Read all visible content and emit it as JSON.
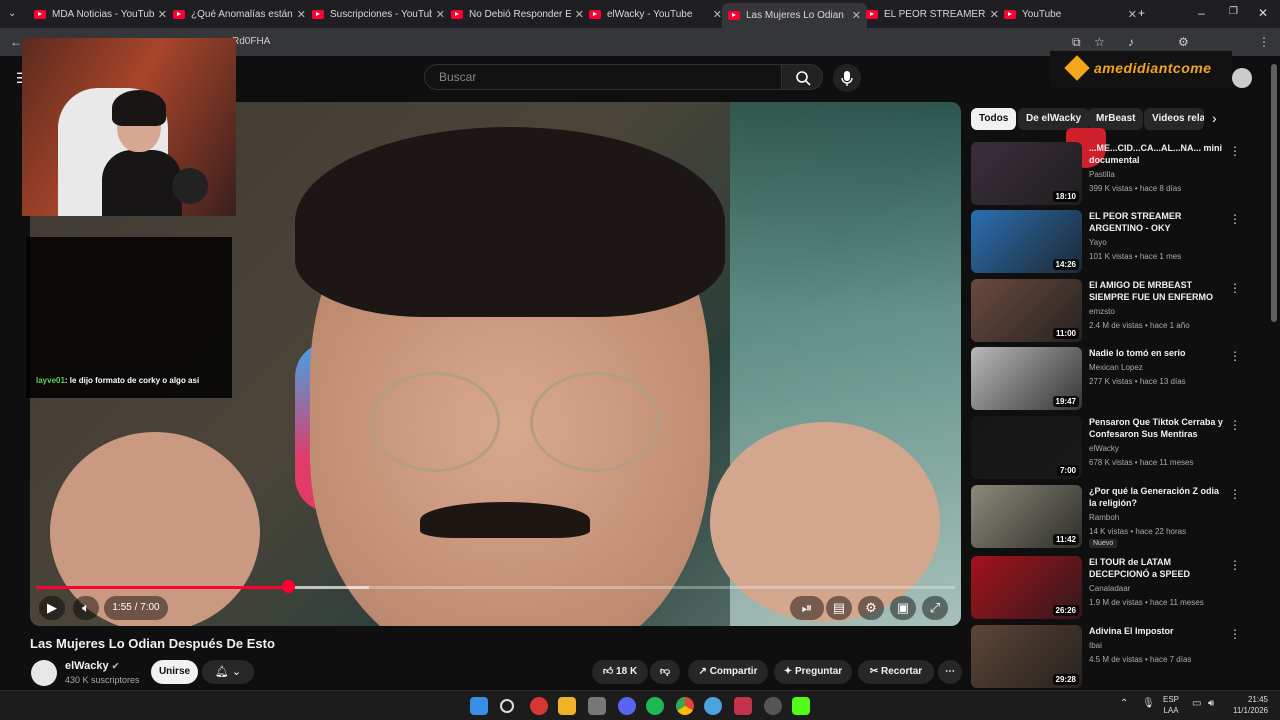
{
  "browser": {
    "tabs": [
      {
        "title": "MDA Noticias - YouTube",
        "active": false
      },
      {
        "title": "¿Qué Anomalías están pr",
        "active": false
      },
      {
        "title": "Suscripciones - YouTube",
        "active": false
      },
      {
        "title": "No Debió Responder Esto",
        "active": false
      },
      {
        "title": "elWacky - YouTube",
        "active": false
      },
      {
        "title": "Las Mujeres Lo Odian",
        "active": true
      },
      {
        "title": "EL PEOR STREAMER ARG",
        "active": false
      },
      {
        "title": "YouTube",
        "active": false
      }
    ],
    "url_fragment": "Rd0FHA"
  },
  "header": {
    "search_placeholder": "Buscar",
    "banner_text": "amedidiantcome"
  },
  "player": {
    "time": "1:55 / 7:00",
    "progress": 0.274,
    "buffered": 0.362
  },
  "overlay": {
    "chat_user": "layve01",
    "chat_message": ": le dijo formato de corky o algo asi"
  },
  "video": {
    "title": "Las Mujeres Lo Odian Después De Esto",
    "channel": "elWacky",
    "subscribers": "430 K suscriptores",
    "join_label": "Unirse",
    "likes": "18 K",
    "share_label": "Compartir",
    "ask_label": "Preguntar",
    "clip_label": "Recortar"
  },
  "chips": [
    "Todos",
    "De elWacky",
    "MrBeast",
    "Videos relac"
  ],
  "recommendations": [
    {
      "title": "...ME...CID...CA...AL...NA... mini documental",
      "channel": "Pastilla",
      "meta": "399 K vistas • hace 8 días",
      "duration": "18:10",
      "color": "#3a2f3a",
      "badge": ""
    },
    {
      "title": "EL PEOR STREAMER ARGENTINO - OKY",
      "channel": "Yayo",
      "meta": "101 K vistas • hace 1 mes",
      "duration": "14:26",
      "color": "#2b6fb0",
      "badge": ""
    },
    {
      "title": "El AMIGO DE MRBEAST SIEMPRE FUE UN ENFERMO D...",
      "channel": "emzsto",
      "meta": "2.4 M de vistas • hace 1 año",
      "duration": "11:00",
      "color": "#6a4a3e",
      "badge": ""
    },
    {
      "title": "Nadie lo tomó en serio",
      "channel": "Mexican Lopez",
      "meta": "277 K vistas • hace 13 días",
      "duration": "19:47",
      "color": "#b9b9b9",
      "badge": ""
    },
    {
      "title": "Pensaron Que Tiktok Cerraba y Confesaron Sus Mentiras",
      "channel": "elWacky",
      "meta": "678 K vistas • hace 11 meses",
      "duration": "7:00",
      "color": "#161616",
      "badge": ""
    },
    {
      "title": "¿Por qué la Generación Z odia la religión?",
      "channel": "Ramboh",
      "meta": "14 K vistas • hace 22 horas",
      "duration": "11:42",
      "color": "#8c8a7a",
      "badge": "Nuevo"
    },
    {
      "title": "El TOUR de LATAM DECEPCIONÓ a SPEED",
      "channel": "Canaladaar",
      "meta": "1.9 M de vistas • hace 11 meses",
      "duration": "26:26",
      "color": "#a5121d",
      "badge": ""
    },
    {
      "title": "Adivina El Impostor",
      "channel": "Ibai",
      "meta": "4.5 M de vistas • hace 7 días",
      "duration": "29:28",
      "color": "#5e4536",
      "badge": ""
    }
  ],
  "taskbar": {
    "lang": "ESP",
    "lang2": "LAA",
    "time": "21:45",
    "date": "11/1/2026"
  },
  "colors": {
    "accent": "#ff0033",
    "bg": "#0f0f0f"
  }
}
